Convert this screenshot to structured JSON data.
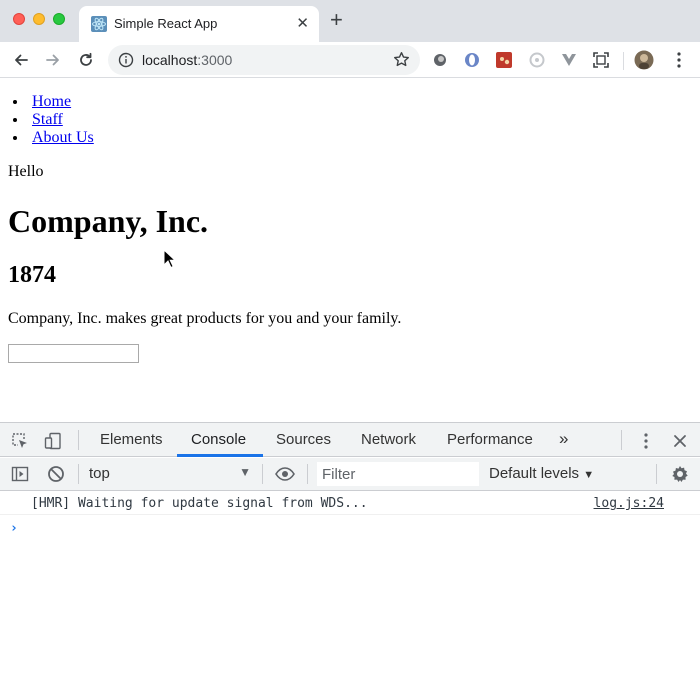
{
  "browser": {
    "tab_title": "Simple React App",
    "tab_close_glyph": "✕",
    "new_tab_glyph": "+",
    "url_host": "localhost",
    "url_port": ":3000",
    "icons": [
      "back-icon",
      "forward-icon",
      "reload-icon",
      "info-icon",
      "star-icon",
      "extensions-icons"
    ]
  },
  "page": {
    "nav": [
      "Home",
      "Staff",
      "About Us"
    ],
    "greeting": "Hello",
    "company_name": "Company, Inc.",
    "founded": "1874",
    "description": "Company, Inc. makes great products for you and your family.",
    "input_value": ""
  },
  "devtools": {
    "tabs": [
      "Elements",
      "Console",
      "Sources",
      "Network",
      "Performance"
    ],
    "active_tab": "Console",
    "more_glyph": "»",
    "context": "top",
    "filter_placeholder": "Filter",
    "levels": "Default levels",
    "levels_arrow": "▼",
    "context_arrow": "▼",
    "log": {
      "message": "[HMR] Waiting for update signal from WDS...",
      "source": "log.js:24"
    },
    "prompt_glyph": "›",
    "accent_color": "#1a73e8"
  }
}
